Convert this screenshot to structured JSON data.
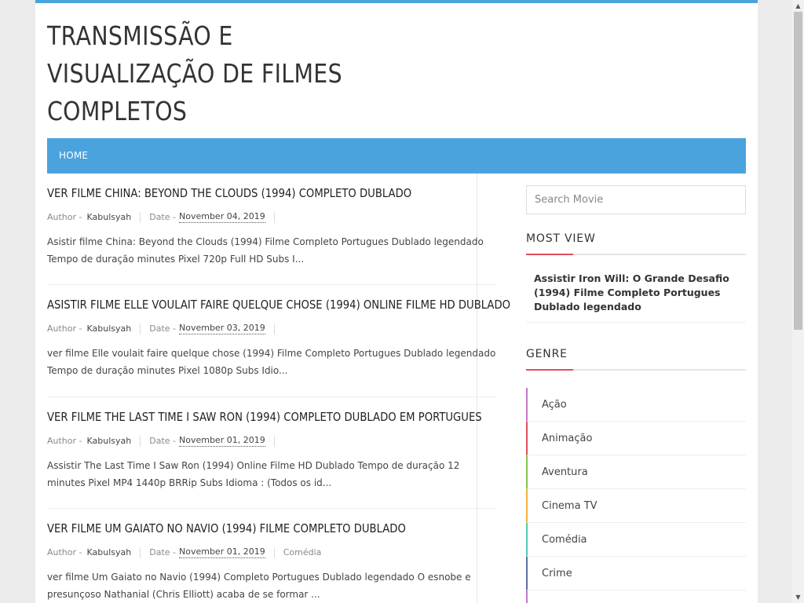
{
  "site": {
    "title": "Transmissão e Visualização de Filmes Completos"
  },
  "nav": {
    "home_label": "Home"
  },
  "posts": [
    {
      "title": "Ver filme China: Beyond the Clouds (1994) Completo Dublado",
      "author_label": "Author -",
      "author": "Kabulsyah",
      "date_label": "Date -",
      "date": "November 04, 2019",
      "category": "",
      "excerpt": "Asistir filme China: Beyond the Clouds (1994) Filme Completo Portugues Dublado legendado Tempo de duração minutes Pixel 720p Full HD Subs I..."
    },
    {
      "title": "Asistir filme Elle voulait faire quelque chose (1994) Online Filme HD Dublado",
      "author_label": "Author -",
      "author": "Kabulsyah",
      "date_label": "Date -",
      "date": "November 03, 2019",
      "category": "",
      "excerpt": "ver filme Elle voulait faire quelque chose (1994) Filme Completo Portugues Dublado legendado Tempo de duração minutes Pixel 1080p Subs Idio..."
    },
    {
      "title": "Ver filme The Last Time I Saw Ron (1994) Completo Dublado em Portugues",
      "author_label": "Author -",
      "author": "Kabulsyah",
      "date_label": "Date -",
      "date": "November 01, 2019",
      "category": "",
      "excerpt": "Assistir The Last Time I Saw Ron (1994) Online Filme HD Dublado Tempo de duração 12 minutes Pixel MP4 1440p BRRip Subs Idioma : (Todos os id..."
    },
    {
      "title": "Ver filme Um Gaiato no Navio (1994) Filme Completo Dublado",
      "author_label": "Author -",
      "author": "Kabulsyah",
      "date_label": "Date -",
      "date": "November 01, 2019",
      "category": "Comédia",
      "excerpt": "ver filme Um Gaiato no Navio (1994) Completo Portugues Dublado legendado O esnobe e presunçoso Nathanial (Chris Elliott) acaba de se formar ..."
    }
  ],
  "sidebar": {
    "search_placeholder": "Search Movie",
    "most_view_title": "Most View",
    "popular_post": "Assistir Iron Will: O Grande Desafio (1994) Filme Completo Portugues Dublado legendado",
    "genre_title": "Genre",
    "genres": [
      {
        "label": "Ação",
        "color": "#c678c9"
      },
      {
        "label": "Animação",
        "color": "#e0505e"
      },
      {
        "label": "Aventura",
        "color": "#8bc34a"
      },
      {
        "label": "Cinema TV",
        "color": "#f5b041"
      },
      {
        "label": "Comédia",
        "color": "#4fc9b6"
      },
      {
        "label": "Crime",
        "color": "#5d6fa3"
      },
      {
        "label": "",
        "color": "#c678c9"
      }
    ]
  },
  "colors": {
    "accent": "#4ba3dd",
    "widget_underline": "#e0505e"
  }
}
